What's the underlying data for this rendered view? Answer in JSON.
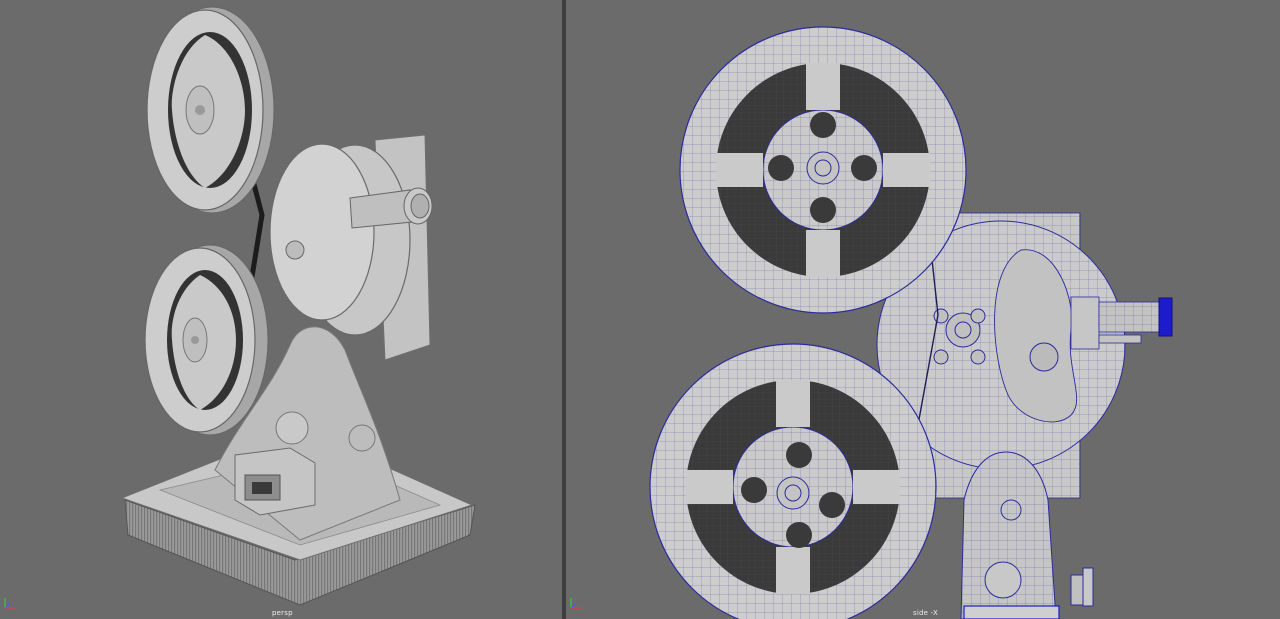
{
  "viewports": {
    "left": {
      "camera_label": "persp"
    },
    "right": {
      "camera_label": "side -X"
    }
  },
  "icons": {
    "axis_gizmo": "xyz-axis-gizmo-icon"
  },
  "colors": {
    "viewport_bg": "#6b6b6b",
    "divider": "#3e3e3e",
    "mesh_light": "#cfcfcf",
    "mesh_mid": "#b4b4b4",
    "mesh_dark": "#3a3a3a",
    "wireframe": "#2b2b9c",
    "selected": "#1c1ccc",
    "axis_x": "#e04040",
    "axis_y": "#40c040",
    "axis_z": "#4060ff"
  }
}
